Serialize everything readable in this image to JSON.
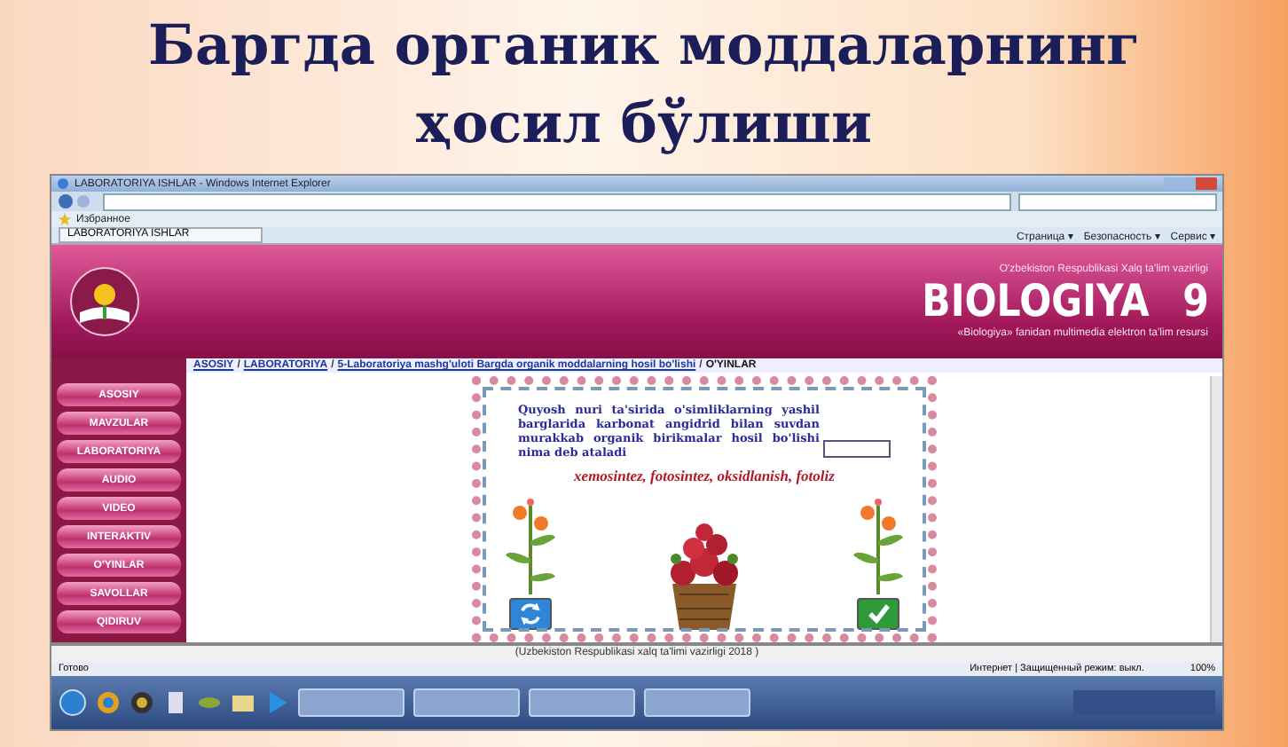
{
  "slide": {
    "title": "Баргда органик моддаларнинг ҳосил бўлиши"
  },
  "browser": {
    "window_title": "LABORATORIYA ISHLAR - Windows Internet Explorer",
    "favorites": "Избранное",
    "tab": "LABORATORIYA ISHLAR",
    "commands": [
      "Страница ▾",
      "Безопасность ▾",
      "Сервис ▾"
    ]
  },
  "header": {
    "ministry": "O'zbekiston Respublikasi Xalq ta'lim vazirligi",
    "title": "BIOLOGIYA",
    "grade": "9",
    "subtitle": "«Biologiya» fanidan multimedia elektron ta'lim resursi"
  },
  "breadcrumb": {
    "separators": [
      "/",
      "/",
      "/"
    ],
    "items": [
      {
        "label": "ASOSIY",
        "link": true
      },
      {
        "label": "LABORATORIYA",
        "link": true
      },
      {
        "label": "5-Laboratoriya mashg'uloti Bargda organik moddalarning hosil bo'lishi",
        "link": true
      },
      {
        "label": "O'YINLAR",
        "link": false
      }
    ]
  },
  "menu": [
    {
      "label": "ASOSIY"
    },
    {
      "label": "MAVZULAR"
    },
    {
      "label": "LABORATORIYA"
    },
    {
      "label": "AUDIO"
    },
    {
      "label": "VIDEO"
    },
    {
      "label": "INTERAKTIV"
    },
    {
      "label": "O'YINLAR"
    },
    {
      "label": "SAVOLLAR"
    },
    {
      "label": "QIDIRUV"
    }
  ],
  "game": {
    "question": "Quyosh nuri ta'sirida o'simliklarning yashil barglarida karbonat angidrid bilan suvdan murakkab organik birikmalar hosil bo'lishi nima deb ataladi",
    "options": "xemosintez, fotosintez, oksidlanish, fotoliz",
    "buttons": [
      {
        "kind": "refresh"
      },
      {
        "kind": "check"
      }
    ]
  },
  "footer": "(Uzbekiston Respublikasi xalq ta'limi vazirligi 2018 )",
  "status": {
    "text": "Готово",
    "zone": "Интернет | Защищенный режим: выкл.",
    "zoom": "100%"
  }
}
